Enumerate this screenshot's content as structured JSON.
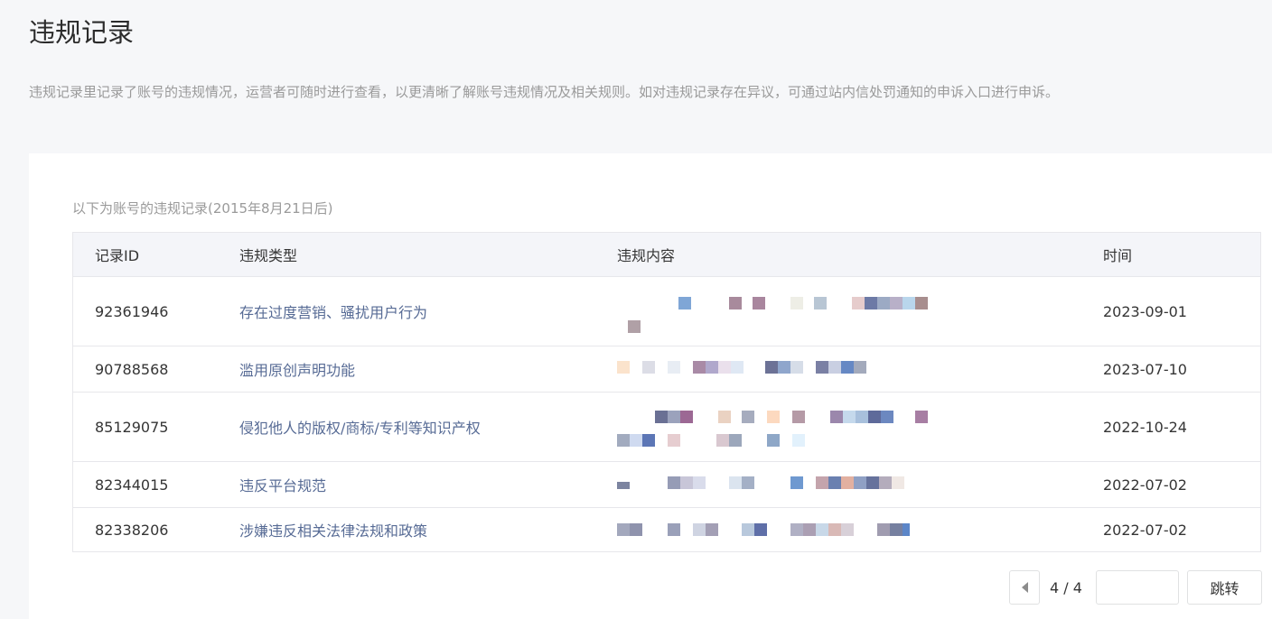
{
  "header": {
    "title": "违规记录",
    "description": "违规记录里记录了账号的违规情况，运营者可随时进行查看，以更清晰了解账号违规情况及相关规则。如对违规记录存在异议，可通过站内信处罚通知的申诉入口进行申诉。"
  },
  "records": {
    "caption": "以下为账号的违规记录(2015年8月21日后)",
    "columns": {
      "id": "记录ID",
      "type": "违规类型",
      "content": "违规内容",
      "time": "时间"
    },
    "rows": [
      {
        "id": "92361946",
        "type": "存在过度营销、骚扰用户行为",
        "content": "[pixelated]",
        "time": "2023-09-01"
      },
      {
        "id": "90788568",
        "type": "滥用原创声明功能",
        "content": "[pixelated]",
        "time": "2023-07-10"
      },
      {
        "id": "85129075",
        "type": "侵犯他人的版权/商标/专利等知识产权",
        "content": "[pixelated]",
        "time": "2022-10-24"
      },
      {
        "id": "82344015",
        "type": "违反平台规范",
        "content": "[pixelated]",
        "time": "2022-07-02"
      },
      {
        "id": "82338206",
        "type": "涉嫌违反相关法律法规和政策",
        "content": "[pixelated]",
        "time": "2022-07-02"
      }
    ]
  },
  "pagination": {
    "prev_icon": "chevron-left-icon",
    "current": "4 / 4",
    "jump_input_value": "",
    "jump_label": "跳转"
  },
  "colors": {
    "link": "#576b95",
    "muted_text": "#9a9a9a",
    "border": "#e7e7eb",
    "header_bg": "#f4f5f9",
    "page_bg": "#f6f7f9"
  }
}
